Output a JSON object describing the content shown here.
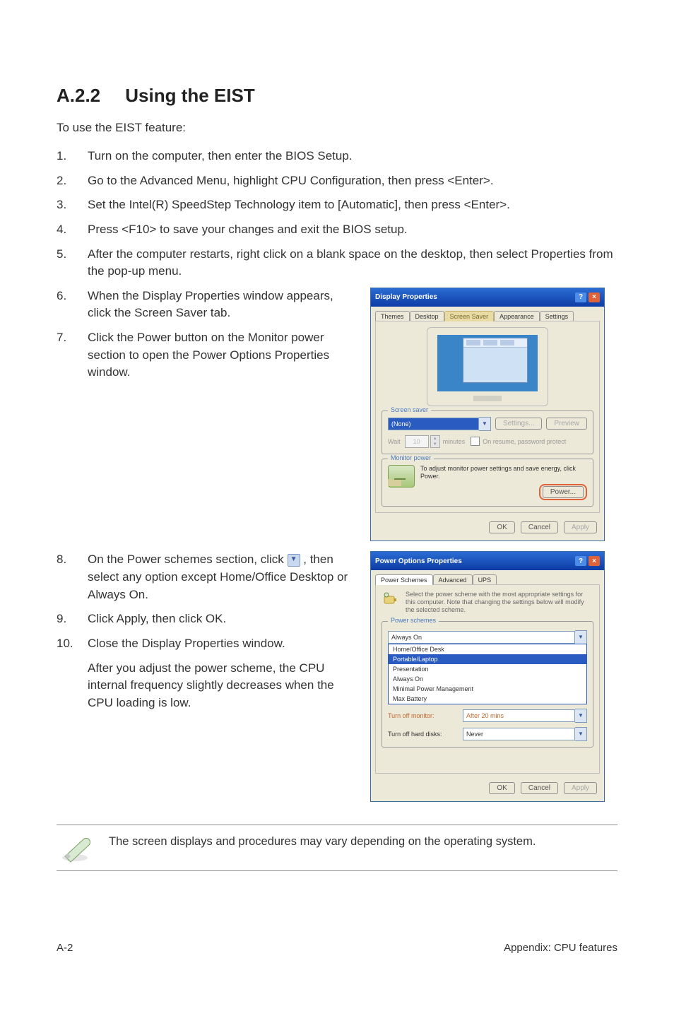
{
  "heading": {
    "num": "A.2.2",
    "title": "Using the EIST"
  },
  "intro": "To use the EIST feature:",
  "steps": [
    {
      "n": "1.",
      "t": "Turn on the computer, then enter the BIOS Setup."
    },
    {
      "n": "2.",
      "t": "Go to the Advanced Menu, highlight CPU Configuration, then press <Enter>."
    },
    {
      "n": "3.",
      "t": "Set the Intel(R) SpeedStep Technology item to [Automatic], then press <Enter>."
    },
    {
      "n": "4.",
      "t": "Press <F10> to save your changes and exit the BIOS setup."
    },
    {
      "n": "5.",
      "t": "After the computer restarts, right click on a blank space on the desktop, then select Properties from the pop-up menu."
    },
    {
      "n": "6.",
      "t": "When the Display Properties window appears, click the Screen Saver tab."
    },
    {
      "n": "7.",
      "t": "Click the Power button on the Monitor power section to open the Power Options Properties window."
    },
    {
      "n": "8.",
      "t_pre": "On the Power schemes section, click ",
      "t_post": ", then select any option except Home/Office Desktop or Always On."
    },
    {
      "n": "9.",
      "t": "Click Apply, then click OK."
    },
    {
      "n": "10.",
      "t": "Close the Display Properties window."
    }
  ],
  "after_adjust": "After you adjust the power scheme, the CPU internal frequency slightly decreases when the CPU loading is low.",
  "note": "The screen displays and procedures may vary depending on the operating system.",
  "footer": {
    "left": "A-2",
    "right": "Appendix: CPU features"
  },
  "dialog1": {
    "title": "Display Properties",
    "tabs": [
      "Themes",
      "Desktop",
      "Screen Saver",
      "Appearance",
      "Settings"
    ],
    "screensaver_legend": "Screen saver",
    "ss_value": "(None)",
    "settings_btn": "Settings...",
    "preview_btn": "Preview",
    "wait_label": "Wait",
    "wait_value": "10",
    "wait_unit": "minutes",
    "resume_chk": "On resume, password protect",
    "monitor_legend": "Monitor power",
    "monitor_desc": "To adjust monitor power settings and save energy, click Power.",
    "power_btn": "Power...",
    "ok": "OK",
    "cancel": "Cancel",
    "apply": "Apply"
  },
  "dialog2": {
    "title": "Power Options Properties",
    "tabs": [
      "Power Schemes",
      "Advanced",
      "UPS"
    ],
    "desc": "Select the power scheme with the most appropriate settings for this computer. Note that changing the settings below will modify the selected scheme.",
    "ps_legend": "Power schemes",
    "ps_value": "Always On",
    "ps_options": [
      "Home/Office Desk",
      "Portable/Laptop",
      "Presentation",
      "Always On",
      "Minimal Power Management",
      "Max Battery"
    ],
    "turn_monitor": "Turn off monitor:",
    "turn_monitor_val": "After 20 mins",
    "turn_hdd": "Turn off hard disks:",
    "turn_hdd_val": "Never",
    "ok": "OK",
    "cancel": "Cancel",
    "apply": "Apply"
  }
}
